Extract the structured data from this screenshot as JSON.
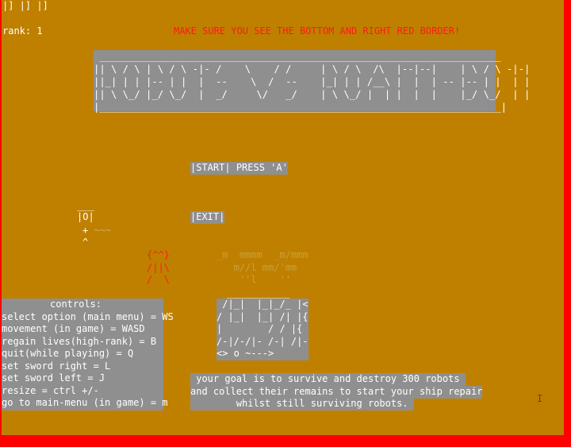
{
  "top_indicator": "|] |] |]",
  "rank_label": "rank: 1",
  "warning": "MAKE SURE YOU SEE THE BOTTOM AND RIGHT RED BORDER!",
  "title_art": " _____________________________________________________________________\n|| \\ / \\ | \\ / \\ -|- /    \\    / /     | \\ / \\  /\\  |--|--|    | \\ / \\ -|-|\n||_| | | |-- | |  |  --    \\  /  --    |_| | | /__\\ |  |  | -- |-- | |  | |\n|| \\ \\_/ |_/ \\_/  |  _/     \\/   _/    | \\ \\_/ |  | |  |  |    |_/ \\_/  | |\n|_____________________________________________________________________|",
  "menu": {
    "start_label": "|START|",
    "start_hint": "PRESS 'A'",
    "exit_label": "|EXIT|"
  },
  "player_art": {
    "hat": "___",
    "head": "|O|",
    "sword": "+",
    "sword_trail": "~~~",
    "feet": "^"
  },
  "robot_art": "{^^}\n/||\\\n/  \\",
  "faded_art": "_m  mmmm  _m/mmm\n   m//l mm/'mm\n    ''l    ''",
  "ship_top": "___________",
  "ship_art": " /|_|  |_|_/_ |<\n/ |_|  |_| /| |{\n|        / / |{\n/-|/-/|- /-| /|-\n<> o ~--->",
  "controls": {
    "title": "controls:",
    "lines": [
      "select option (main menu) = WS",
      "movement (in game) = WASD",
      "regain lives(high-rank) = B",
      "quit(while playing) = Q",
      "set sword right = L",
      "set sword left = J",
      "resize = ctrl +/-",
      "go to main-menu (in game) = m"
    ]
  },
  "goal_text": {
    "line1": " your goal is to survive and destroy 300 robots ",
    "line2": "and collect their remains to start your ship repair",
    "line3": "        whilst still surviving robots. "
  },
  "cursor_glyph": "I",
  "colors": {
    "background": "#bf8000",
    "border": "#ff0000",
    "panel": "#8f8f8f",
    "warning_text": "#ff1a1a"
  }
}
